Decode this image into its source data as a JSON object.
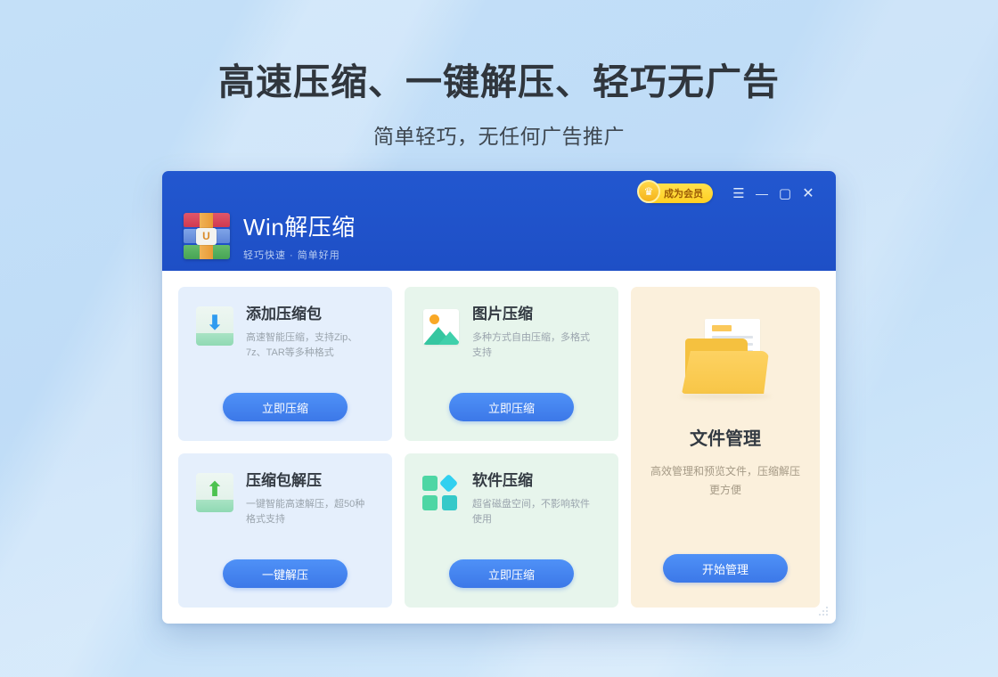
{
  "hero": {
    "title": "高速压缩、一键解压、轻巧无广告",
    "subtitle": "简单轻巧，无任何广告推广"
  },
  "window": {
    "brand": {
      "title": "Win解压缩",
      "subtitle": "轻巧快速 · 简单好用",
      "logo_icon": "winrar-books-icon",
      "buckle_letter": "U"
    },
    "titlebar": {
      "vip_label": "成为会员",
      "vip_icon": "crown-icon",
      "menu_icon": "☰",
      "minimize_icon": "—",
      "maximize_icon": "▢",
      "close_icon": "✕"
    },
    "cards": [
      {
        "icon": "archive-download-icon",
        "title": "添加压缩包",
        "desc": "高速智能压缩，支持Zip、7z、TAR等多种格式",
        "button": "立即压缩",
        "theme": "blue"
      },
      {
        "icon": "image-icon",
        "title": "图片压缩",
        "desc": "多种方式自由压缩，多格式支持",
        "button": "立即压缩",
        "theme": "green"
      },
      {
        "icon": "archive-upload-icon",
        "title": "压缩包解压",
        "desc": "一键智能高速解压，超50种格式支持",
        "button": "一键解压",
        "theme": "blue"
      },
      {
        "icon": "tiles-icon",
        "title": "软件压缩",
        "desc": "超省磁盘空间，不影响软件使用",
        "button": "立即压缩",
        "theme": "green"
      }
    ],
    "promo": {
      "icon": "folder-document-icon",
      "title": "文件管理",
      "desc": "高效管理和预览文件，压缩解压更方便",
      "button": "开始管理"
    },
    "resize_grip_icon": "resize-grip-icon"
  },
  "colors": {
    "page_background": "#bfdcf7",
    "titlebar": "#1e4fc6",
    "button": "#3c78e8",
    "vip_badge": "#ffcf23",
    "card_blue": "#e5effc",
    "card_green": "#e7f5ec",
    "promo_panel": "#fbf0dc"
  }
}
